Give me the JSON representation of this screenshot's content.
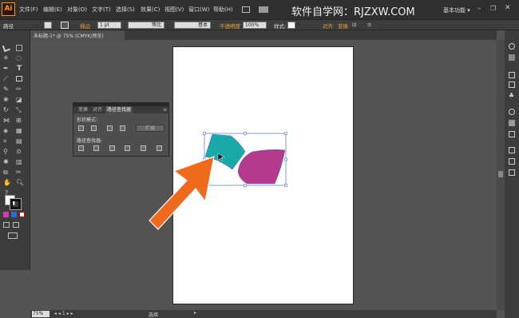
{
  "app": {
    "logo": "Ai"
  },
  "menubar": {
    "items": [
      {
        "label": "文件(F)"
      },
      {
        "label": "编辑(E)"
      },
      {
        "label": "对象(O)"
      },
      {
        "label": "文字(T)"
      },
      {
        "label": "选择(S)"
      },
      {
        "label": "效果(C)"
      },
      {
        "label": "视图(V)"
      },
      {
        "label": "窗口(W)"
      },
      {
        "label": "帮助(H)"
      }
    ],
    "watermark": "软件自学网：RJZXW.COM",
    "workspace": "基本功能 ▾"
  },
  "control": {
    "object_type": "路径",
    "stroke_label": "描边",
    "stroke_weight": "1 pt",
    "profile_1": "等比",
    "profile_2": "基本",
    "opacity_label": "不透明度",
    "opacity_value": "100%",
    "style_label": "样式:",
    "align_label": "对齐",
    "transform_label": "变换"
  },
  "document": {
    "tab": "未标题-1* @ 75% (CMYK/预览)",
    "zoom": "75%",
    "status": "选择"
  },
  "pathfinder": {
    "tabs": [
      "变换",
      "对齐",
      "路径查找器"
    ],
    "shape_modes_label": "形状模式:",
    "expand_label": "扩展",
    "pathfinders_label": "路径查找器:"
  },
  "shapes": {
    "teal_color": "#1aa9a9",
    "magenta_color": "#b63a8c",
    "arrow_color": "#f06a1e",
    "selection_color": "#4a6fd8"
  }
}
